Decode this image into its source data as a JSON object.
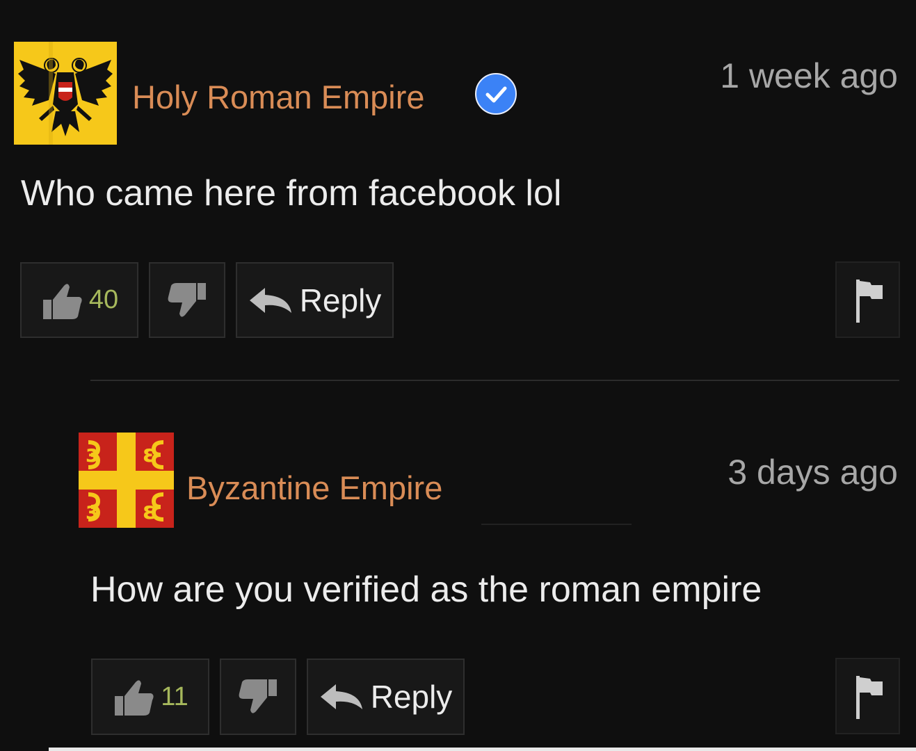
{
  "comments": [
    {
      "username": "Holy Roman Empire",
      "verified": true,
      "timestamp": "1 week ago",
      "body": "Who came here from facebook lol",
      "likes": "40",
      "reply_label": "Reply",
      "avatar_icon": "holy-roman-eagle-flag"
    },
    {
      "username": "Byzantine Empire",
      "verified": false,
      "timestamp": "3 days ago",
      "body": "How are you verified as the roman empire",
      "likes": "11",
      "reply_label": "Reply",
      "avatar_icon": "byzantine-tetragrammic-cross-flag"
    }
  ],
  "colors": {
    "background": "#0f0f0f",
    "username": "#d98c56",
    "like_count": "#a6b85c",
    "verified_badge": "#3b82f6"
  }
}
